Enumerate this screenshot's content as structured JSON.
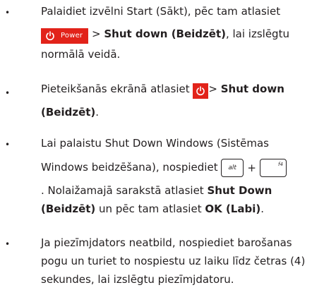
{
  "items": [
    {
      "bullet": "•",
      "lines": {
        "l1": "Palaidiet izvēlni Start (Sākt), pēc tam atlasiet",
        "l2_power_label": "Power",
        "l2_sep": " > ",
        "l2_bold": "Shut down (Beidzēt)",
        "l2_rest": ", lai izslēgtu",
        "l3": "normālā veidā."
      }
    },
    {
      "bullet": "•",
      "lines": {
        "l1": "Pieteikšanās ekrānā atlasiet ",
        "l1_sep": "> ",
        "l1_bold": "Shut down",
        "l2_bold": "(Beidzēt)",
        "l2_rest": "."
      }
    },
    {
      "bullet": "•",
      "lines": {
        "l1": "Lai palaistu Shut Down Windows (Sistēmas",
        "l2": "Windows beidzēšana), nospiediet",
        "key_alt": "alt",
        "plus": "+",
        "key_f4": "f4",
        "l3": ". Nolaižamajā sarakstā atlasiet ",
        "l3_bold": "Shut Down",
        "l4_bold": "(Beidzēt)",
        "l4_mid": " un pēc tam atlasiet ",
        "l4_bold2": "OK (Labi)",
        "l4_end": "."
      }
    },
    {
      "bullet": "•",
      "lines": {
        "l1": "Ja piezīmjdators neatbild, nospiediet barošanas",
        "l2": "pogu un turiet to nospiestu uz laiku līdz četras (4)",
        "l3": "sekundes, lai izslēgtu piezīmjdatoru."
      }
    }
  ],
  "icons": {
    "power": "power-icon"
  },
  "colors": {
    "accent": "#e2231a",
    "text": "#231f20"
  }
}
